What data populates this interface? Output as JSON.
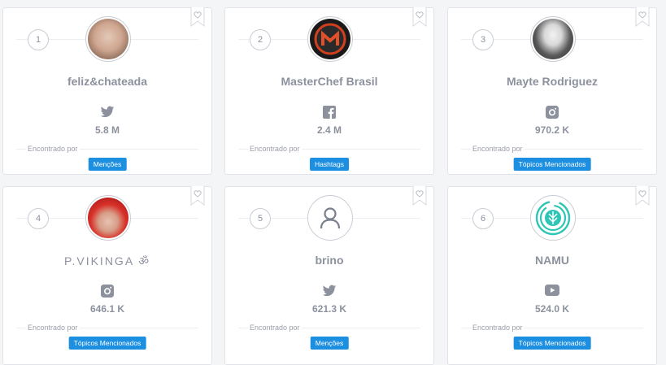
{
  "found_label": "Encontrado por",
  "colors": {
    "accent": "#1d8fe1",
    "text_muted": "#8c919d",
    "icon": "#8c919d"
  },
  "cards": [
    {
      "rank": "1",
      "name": "feliz&chateada",
      "network": "twitter-icon",
      "followers": "5.8 M",
      "found_by": "Menções"
    },
    {
      "rank": "2",
      "name": "MasterChef Brasil",
      "network": "facebook-icon",
      "followers": "2.4 M",
      "found_by": "Hashtags"
    },
    {
      "rank": "3",
      "name": "Mayte Rodriguez",
      "network": "instagram-icon",
      "followers": "970.2 K",
      "found_by": "Tópicos Mencionados"
    },
    {
      "rank": "4",
      "name": "P.VIKINGA ॐ",
      "network": "instagram-icon",
      "followers": "646.1 K",
      "found_by": "Tópicos Mencionados"
    },
    {
      "rank": "5",
      "name": "brino",
      "network": "twitter-icon",
      "followers": "621.3 K",
      "found_by": "Menções"
    },
    {
      "rank": "6",
      "name": "NAMU",
      "network": "youtube-icon",
      "followers": "524.0 K",
      "found_by": "Tópicos Mencionados"
    }
  ]
}
